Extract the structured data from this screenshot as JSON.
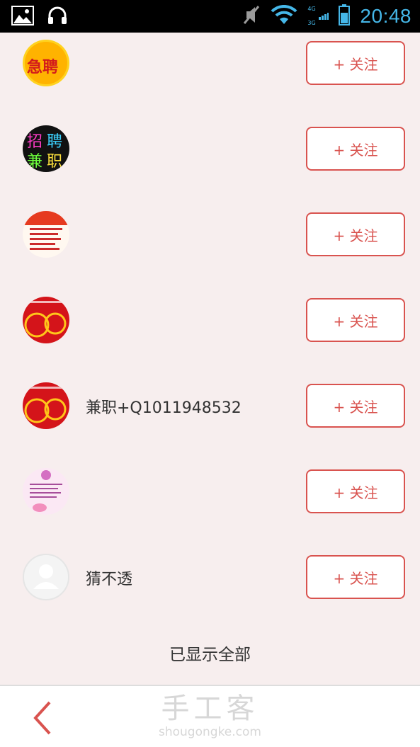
{
  "status_bar": {
    "time": "20:48",
    "network_top": "4G",
    "network_bottom": "3G",
    "icons": [
      "image-icon",
      "headphones-icon",
      "mute-icon",
      "wifi-icon",
      "signal-icon",
      "battery-icon"
    ]
  },
  "list": {
    "follow_label": "+ 关注",
    "items": [
      {
        "name": "",
        "avatar": "urgent-hiring-avatar"
      },
      {
        "name": "",
        "avatar": "neon-hiring-avatar"
      },
      {
        "name": "",
        "avatar": "hiring-flyer-avatar"
      },
      {
        "name": "",
        "avatar": "red-hiring-avatar"
      },
      {
        "name": "兼职+Q1011948532",
        "avatar": "red-hiring-avatar"
      },
      {
        "name": "",
        "avatar": "pink-flyer-avatar"
      },
      {
        "name": "猜不透",
        "avatar": "default-user-avatar"
      }
    ]
  },
  "footer_note": "已显示全部",
  "bottom_bar": {
    "brand_cn": "手工客",
    "brand_en": "shougongke.com",
    "back_icon": "chevron-left-icon"
  },
  "colors": {
    "accent": "#d9534f",
    "background": "#f7eeee",
    "time": "#45b7e8"
  }
}
